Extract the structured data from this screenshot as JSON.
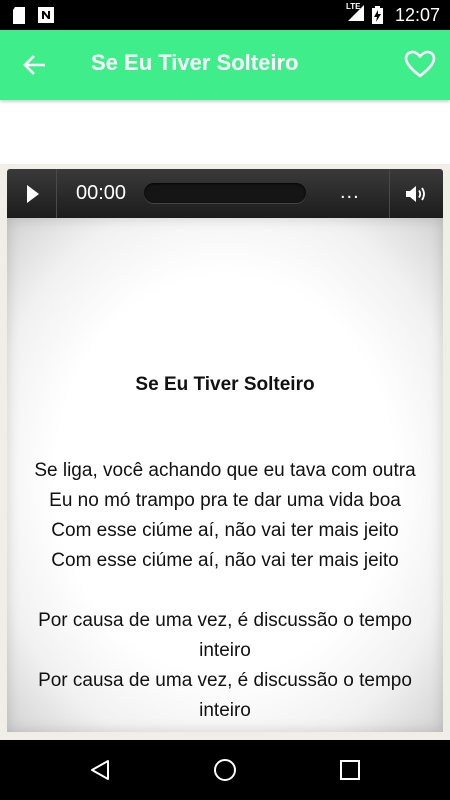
{
  "status_bar": {
    "network_label": "LTE",
    "time": "12:07"
  },
  "app_bar": {
    "title": "Se Eu Tiver Solteiro",
    "back_icon": "arrow-left-icon",
    "favorite_icon": "heart-outline-icon"
  },
  "player": {
    "current_time": "00:00",
    "duration": "...",
    "play_icon": "play-icon",
    "volume_icon": "volume-icon"
  },
  "lyrics": {
    "title": "Se Eu Tiver Solteiro",
    "verses": [
      {
        "lines": [
          "Se liga, você achando que eu tava com outra",
          "Eu no mó trampo pra te dar uma vida boa",
          "Com esse ciúme aí, não vai ter mais jeito",
          "Com esse ciúme aí, não vai ter mais jeito"
        ]
      },
      {
        "lines": [
          "Por causa de uma vez, é discussão o tempo",
          "inteiro",
          "Por causa de uma vez, é discussão o tempo",
          "inteiro"
        ]
      }
    ]
  },
  "nav_bar": {
    "back_icon": "nav-back-icon",
    "home_icon": "nav-home-icon",
    "recents_icon": "nav-recents-icon"
  },
  "colors": {
    "app_bar": "#3fee8b",
    "frame": "#efefe8",
    "player": "#2a2a2a"
  }
}
